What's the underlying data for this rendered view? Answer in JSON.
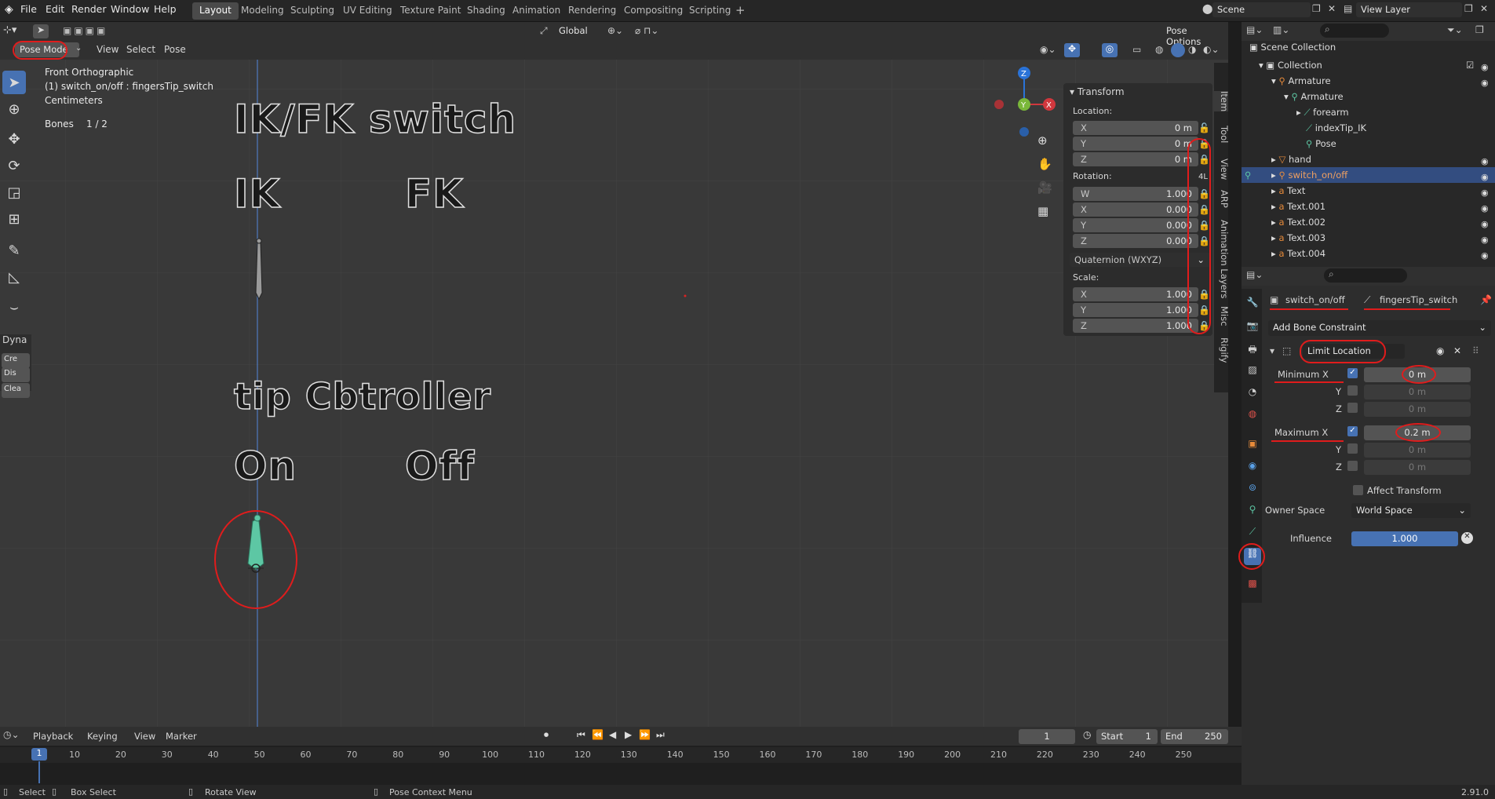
{
  "menus": [
    "File",
    "Edit",
    "Render",
    "Window",
    "Help"
  ],
  "workspaces": [
    "Layout",
    "Modeling",
    "Sculpting",
    "UV Editing",
    "Texture Paint",
    "Shading",
    "Animation",
    "Rendering",
    "Compositing",
    "Scripting"
  ],
  "scene": "Scene",
  "view_layer": "View Layer",
  "mode": "Pose Mode",
  "view_menus": [
    "View",
    "Select",
    "Pose"
  ],
  "transform_orientation": "Global",
  "pose_options": "Pose Options",
  "overlay": {
    "line1": "Front Orthographic",
    "line2": "(1) switch_on/off : fingersTip_switch",
    "line3": "Centimeters",
    "bones_label": "Bones",
    "bones_value": "1 / 2"
  },
  "viewport_text": {
    "t1": "IK/FK switch",
    "t2": "IK",
    "t3": "FK",
    "t4": "tip Cbtroller",
    "t5": "On",
    "t6": "Off"
  },
  "toolshelf": {
    "title": "Dyna",
    "btn1": "Cre",
    "btn2": "Dis",
    "btn3": "Clea"
  },
  "gizmo": {
    "z": "Z",
    "y": "Y",
    "x": "X"
  },
  "transform_panel": {
    "title": "Transform",
    "location_label": "Location:",
    "location": [
      {
        "k": "X",
        "v": "0 m"
      },
      {
        "k": "Y",
        "v": "0 m"
      },
      {
        "k": "Z",
        "v": "0 m"
      }
    ],
    "rotation_label": "Rotation:",
    "rotation": [
      {
        "k": "W",
        "v": "1.000"
      },
      {
        "k": "X",
        "v": "0.000"
      },
      {
        "k": "Y",
        "v": "0.000"
      },
      {
        "k": "Z",
        "v": "0.000"
      }
    ],
    "rotation_mode": "Quaternion (WXYZ)",
    "scale_label": "Scale:",
    "scale": [
      {
        "k": "X",
        "v": "1.000"
      },
      {
        "k": "Y",
        "v": "1.000"
      },
      {
        "k": "Z",
        "v": "1.000"
      }
    ],
    "lock_4l": "4L"
  },
  "sidebar_tabs": [
    "Item",
    "Tool",
    "View",
    "ARP",
    "Animation Layers",
    "Misc",
    "Rigify"
  ],
  "outliner": {
    "scene_collection": "Scene Collection",
    "rows": [
      "Collection",
      "Armature",
      "Armature",
      "forearm",
      "indexTip_IK",
      "Pose",
      "hand",
      "switch_on/off",
      "Text",
      "Text.001",
      "Text.002",
      "Text.003",
      "Text.004"
    ]
  },
  "properties": {
    "object": "switch_on/off",
    "bone": "fingersTip_switch",
    "add_constraint": "Add Bone Constraint",
    "constraint_name": "Limit Location",
    "min_x_label": "Minimum X",
    "min_x": "0 m",
    "min_y_label": "Y",
    "min_y": "0 m",
    "min_z_label": "Z",
    "min_z": "0 m",
    "max_x_label": "Maximum X",
    "max_x": "0.2 m",
    "max_y_label": "Y",
    "max_y": "0 m",
    "max_z_label": "Z",
    "max_z": "0 m",
    "affect_transform": "Affect Transform",
    "owner_space_label": "Owner Space",
    "owner_space": "World Space",
    "influence_label": "Influence",
    "influence": "1.000"
  },
  "timeline": {
    "menus": [
      "Playback",
      "Keying",
      "View",
      "Marker"
    ],
    "current_frame": "1",
    "start_label": "Start",
    "start": "1",
    "end_label": "End",
    "end": "250",
    "ticks": [
      "10",
      "20",
      "30",
      "40",
      "50",
      "60",
      "70",
      "80",
      "90",
      "100",
      "110",
      "120",
      "130",
      "140",
      "150",
      "160",
      "170",
      "180",
      "190",
      "200",
      "210",
      "220",
      "230",
      "240",
      "250"
    ],
    "current": "1"
  },
  "status": {
    "select": "Select",
    "box_select": "Box Select",
    "rotate_view": "Rotate View",
    "context_menu": "Pose Context Menu",
    "version": "2.91.0"
  },
  "colors": {
    "accent": "#4772b3",
    "bone": "#5dc7a4",
    "annotation": "#e01c1c",
    "selected_row": "#334d80"
  }
}
